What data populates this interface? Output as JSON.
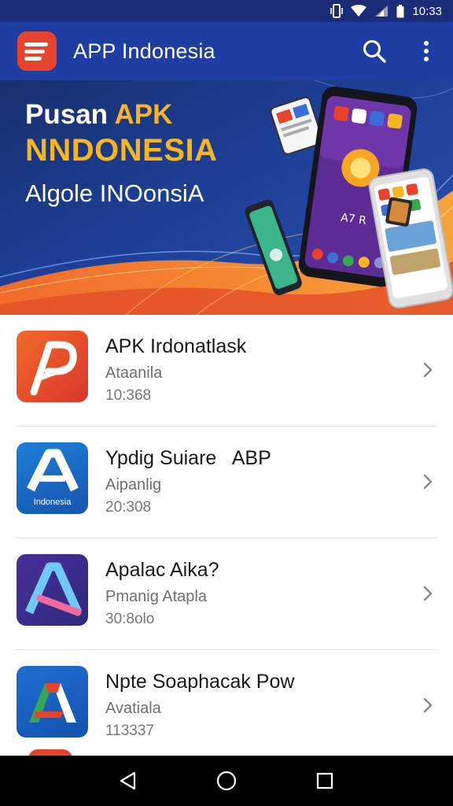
{
  "status_bar": {
    "time": "10:33",
    "icons": [
      "vibrate-icon",
      "wifi-icon",
      "signal-icon",
      "battery-icon"
    ]
  },
  "app_bar": {
    "title": "APP Indonesia",
    "icons": [
      "app-logo",
      "search-icon",
      "more-vert-icon"
    ]
  },
  "banner": {
    "line1_white": "Pusan ",
    "line1_accent": "APK",
    "line2": "NNDONESIA",
    "line3": "Algole INOonsiA"
  },
  "apps": [
    {
      "title": "APK Irdonatlask",
      "subtitle": "Ataanila",
      "meta": "10:368",
      "icon": "red-p-logo-icon"
    },
    {
      "title": "Ypdig Suiare   ABP",
      "subtitle": "Aipanlig",
      "meta": "20:308",
      "icon": "blue-a-logo-icon",
      "icon_caption": "Indonesia"
    },
    {
      "title": "Apalac Aika?",
      "subtitle": "Pmanig Atapla",
      "meta": "30:8olo",
      "icon": "purple-a-logo-icon"
    },
    {
      "title": "Npte Soaphacak Pow",
      "subtitle": "Avatiala",
      "meta": "113337",
      "icon": "tricolor-a-logo-icon"
    }
  ],
  "nav_bar": {
    "icons": [
      "back-icon",
      "home-icon",
      "recents-icon"
    ]
  },
  "colors": {
    "status_bar": "#1b2d78",
    "app_bar": "#1f3ea3",
    "accent_yellow": "#f7b520",
    "accent_red": "#e8432c"
  }
}
